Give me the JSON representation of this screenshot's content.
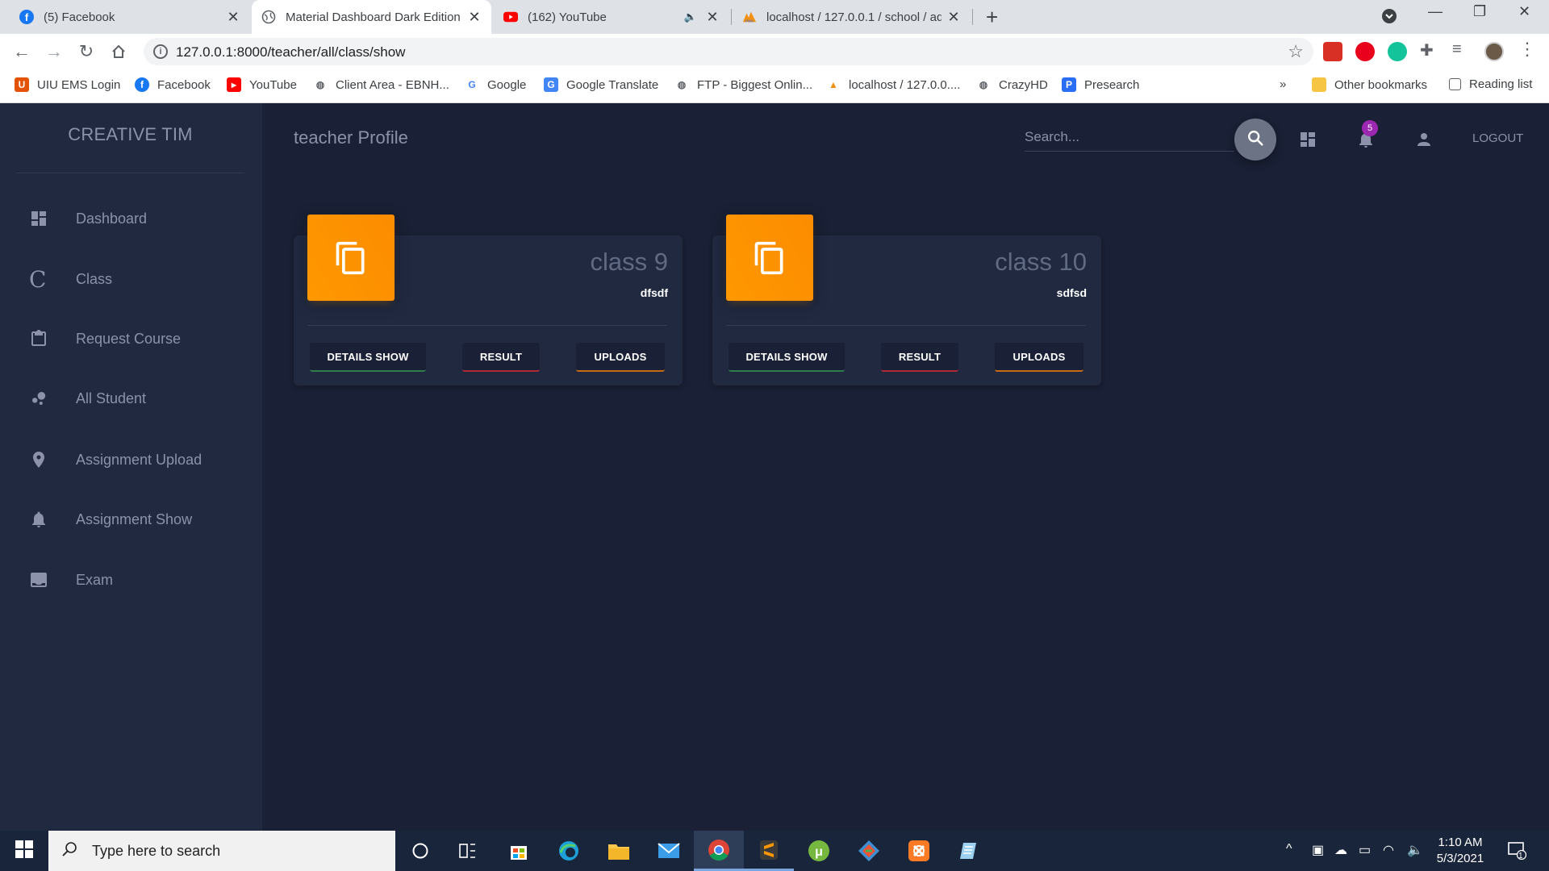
{
  "browser": {
    "tabs": [
      {
        "label": "(5) Facebook",
        "icon": "facebook-icon"
      },
      {
        "label": "Material Dashboard Dark Edition",
        "icon": "globe-icon"
      },
      {
        "label": "(162) YouTube",
        "icon": "youtube-icon"
      },
      {
        "label": "localhost / 127.0.0.1 / school / ad",
        "icon": "phpmyadmin-icon"
      }
    ],
    "url": "127.0.0.1:8000/teacher/all/class/show",
    "bookmarks": [
      "UIU EMS Login",
      "Facebook",
      "YouTube",
      "Client Area - EBNH...",
      "Google",
      "Google Translate",
      "FTP - Biggest Onlin...",
      "localhost / 127.0.0....",
      "CrazyHD",
      "Presearch"
    ],
    "bookmarks_more": "»",
    "other_bookmarks": "Other bookmarks",
    "reading_list": "Reading list"
  },
  "sidebar": {
    "brand": "CREATIVE TIM",
    "items": [
      {
        "label": "Dashboard",
        "icon": "dashboard-icon"
      },
      {
        "label": "Class",
        "icon": "class-c-icon",
        "glyph": "C"
      },
      {
        "label": "Request Course",
        "icon": "clipboard-icon"
      },
      {
        "label": "All Student",
        "icon": "bubble-chart-icon"
      },
      {
        "label": "Assignment Upload",
        "icon": "location-pin-icon"
      },
      {
        "label": "Assignment Show",
        "icon": "bell-icon"
      },
      {
        "label": "Exam",
        "icon": "archive-icon"
      }
    ]
  },
  "header": {
    "title": "teacher Profile",
    "search_placeholder": "Search...",
    "notification_count": "5",
    "logout": "LOGOUT"
  },
  "cards": [
    {
      "title": "class 9",
      "subtitle": "dfsdf",
      "buttons": [
        "DETAILS SHOW",
        "RESULT",
        "UPLOADS"
      ]
    },
    {
      "title": "class 10",
      "subtitle": "sdfsd",
      "buttons": [
        "DETAILS SHOW",
        "RESULT",
        "UPLOADS"
      ]
    }
  ],
  "taskbar": {
    "search_placeholder": "Type here to search",
    "time": "1:10 AM",
    "date": "5/3/2021",
    "notification_count": "1"
  },
  "colors": {
    "sidebar_bg": "#202940",
    "main_bg": "#1a2035",
    "card_icon_orange": "#ff9800",
    "badge_purple": "#9c27b0"
  }
}
